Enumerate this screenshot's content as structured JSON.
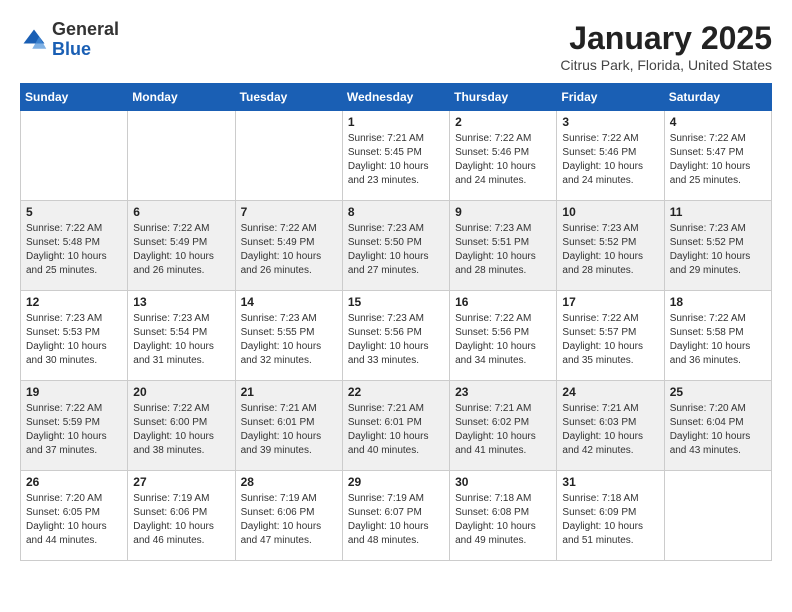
{
  "header": {
    "logo_general": "General",
    "logo_blue": "Blue",
    "month_title": "January 2025",
    "location": "Citrus Park, Florida, United States"
  },
  "weekdays": [
    "Sunday",
    "Monday",
    "Tuesday",
    "Wednesday",
    "Thursday",
    "Friday",
    "Saturday"
  ],
  "weeks": [
    [
      {
        "day": "",
        "info": ""
      },
      {
        "day": "",
        "info": ""
      },
      {
        "day": "",
        "info": ""
      },
      {
        "day": "1",
        "info": "Sunrise: 7:21 AM\nSunset: 5:45 PM\nDaylight: 10 hours\nand 23 minutes."
      },
      {
        "day": "2",
        "info": "Sunrise: 7:22 AM\nSunset: 5:46 PM\nDaylight: 10 hours\nand 24 minutes."
      },
      {
        "day": "3",
        "info": "Sunrise: 7:22 AM\nSunset: 5:46 PM\nDaylight: 10 hours\nand 24 minutes."
      },
      {
        "day": "4",
        "info": "Sunrise: 7:22 AM\nSunset: 5:47 PM\nDaylight: 10 hours\nand 25 minutes."
      }
    ],
    [
      {
        "day": "5",
        "info": "Sunrise: 7:22 AM\nSunset: 5:48 PM\nDaylight: 10 hours\nand 25 minutes."
      },
      {
        "day": "6",
        "info": "Sunrise: 7:22 AM\nSunset: 5:49 PM\nDaylight: 10 hours\nand 26 minutes."
      },
      {
        "day": "7",
        "info": "Sunrise: 7:22 AM\nSunset: 5:49 PM\nDaylight: 10 hours\nand 26 minutes."
      },
      {
        "day": "8",
        "info": "Sunrise: 7:23 AM\nSunset: 5:50 PM\nDaylight: 10 hours\nand 27 minutes."
      },
      {
        "day": "9",
        "info": "Sunrise: 7:23 AM\nSunset: 5:51 PM\nDaylight: 10 hours\nand 28 minutes."
      },
      {
        "day": "10",
        "info": "Sunrise: 7:23 AM\nSunset: 5:52 PM\nDaylight: 10 hours\nand 28 minutes."
      },
      {
        "day": "11",
        "info": "Sunrise: 7:23 AM\nSunset: 5:52 PM\nDaylight: 10 hours\nand 29 minutes."
      }
    ],
    [
      {
        "day": "12",
        "info": "Sunrise: 7:23 AM\nSunset: 5:53 PM\nDaylight: 10 hours\nand 30 minutes."
      },
      {
        "day": "13",
        "info": "Sunrise: 7:23 AM\nSunset: 5:54 PM\nDaylight: 10 hours\nand 31 minutes."
      },
      {
        "day": "14",
        "info": "Sunrise: 7:23 AM\nSunset: 5:55 PM\nDaylight: 10 hours\nand 32 minutes."
      },
      {
        "day": "15",
        "info": "Sunrise: 7:23 AM\nSunset: 5:56 PM\nDaylight: 10 hours\nand 33 minutes."
      },
      {
        "day": "16",
        "info": "Sunrise: 7:22 AM\nSunset: 5:56 PM\nDaylight: 10 hours\nand 34 minutes."
      },
      {
        "day": "17",
        "info": "Sunrise: 7:22 AM\nSunset: 5:57 PM\nDaylight: 10 hours\nand 35 minutes."
      },
      {
        "day": "18",
        "info": "Sunrise: 7:22 AM\nSunset: 5:58 PM\nDaylight: 10 hours\nand 36 minutes."
      }
    ],
    [
      {
        "day": "19",
        "info": "Sunrise: 7:22 AM\nSunset: 5:59 PM\nDaylight: 10 hours\nand 37 minutes."
      },
      {
        "day": "20",
        "info": "Sunrise: 7:22 AM\nSunset: 6:00 PM\nDaylight: 10 hours\nand 38 minutes."
      },
      {
        "day": "21",
        "info": "Sunrise: 7:21 AM\nSunset: 6:01 PM\nDaylight: 10 hours\nand 39 minutes."
      },
      {
        "day": "22",
        "info": "Sunrise: 7:21 AM\nSunset: 6:01 PM\nDaylight: 10 hours\nand 40 minutes."
      },
      {
        "day": "23",
        "info": "Sunrise: 7:21 AM\nSunset: 6:02 PM\nDaylight: 10 hours\nand 41 minutes."
      },
      {
        "day": "24",
        "info": "Sunrise: 7:21 AM\nSunset: 6:03 PM\nDaylight: 10 hours\nand 42 minutes."
      },
      {
        "day": "25",
        "info": "Sunrise: 7:20 AM\nSunset: 6:04 PM\nDaylight: 10 hours\nand 43 minutes."
      }
    ],
    [
      {
        "day": "26",
        "info": "Sunrise: 7:20 AM\nSunset: 6:05 PM\nDaylight: 10 hours\nand 44 minutes."
      },
      {
        "day": "27",
        "info": "Sunrise: 7:19 AM\nSunset: 6:06 PM\nDaylight: 10 hours\nand 46 minutes."
      },
      {
        "day": "28",
        "info": "Sunrise: 7:19 AM\nSunset: 6:06 PM\nDaylight: 10 hours\nand 47 minutes."
      },
      {
        "day": "29",
        "info": "Sunrise: 7:19 AM\nSunset: 6:07 PM\nDaylight: 10 hours\nand 48 minutes."
      },
      {
        "day": "30",
        "info": "Sunrise: 7:18 AM\nSunset: 6:08 PM\nDaylight: 10 hours\nand 49 minutes."
      },
      {
        "day": "31",
        "info": "Sunrise: 7:18 AM\nSunset: 6:09 PM\nDaylight: 10 hours\nand 51 minutes."
      },
      {
        "day": "",
        "info": ""
      }
    ]
  ]
}
